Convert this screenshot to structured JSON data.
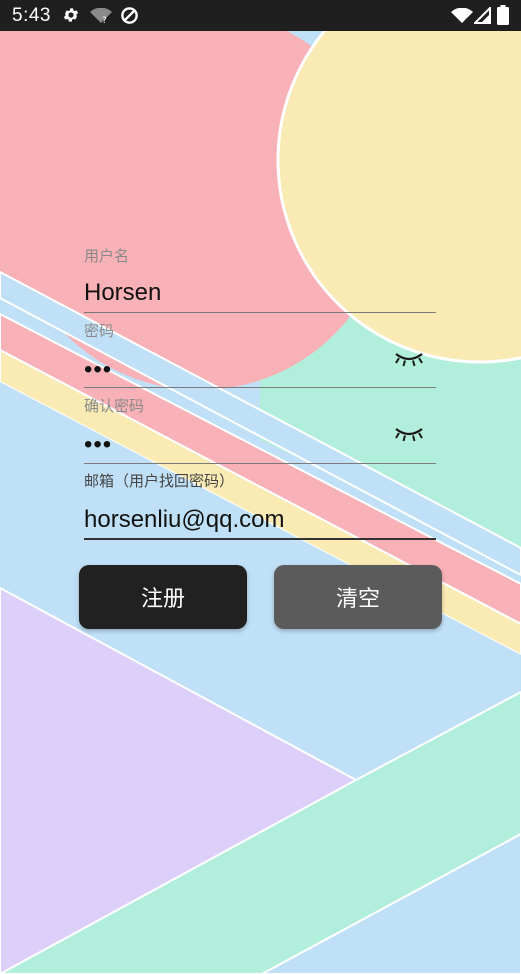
{
  "status_bar": {
    "time": "5:43",
    "icons": [
      "gear-icon",
      "wifi-question-icon",
      "data-saver-icon",
      "wifi-x-icon",
      "cell-signal-icon",
      "battery-icon"
    ]
  },
  "form": {
    "username": {
      "label": "用户名",
      "value": "Horsen"
    },
    "password": {
      "label": "密码",
      "value": "•••",
      "toggle_icon": "eye-closed-icon"
    },
    "confirm_password": {
      "label": "确认密码",
      "value": "•••",
      "toggle_icon": "eye-closed-icon"
    },
    "email": {
      "label": "邮箱（用户找回密码）",
      "value": "horsenliu@qq.com"
    }
  },
  "buttons": {
    "register": "注册",
    "clear": "清空"
  },
  "colors": {
    "pink": "#f8b1b7",
    "yellow": "#faebb4",
    "mint": "#b2eedc",
    "blue": "#bfe0f6",
    "lavender": "#dccffa",
    "button_primary": "#212121",
    "button_secondary": "#5b5b5b"
  }
}
